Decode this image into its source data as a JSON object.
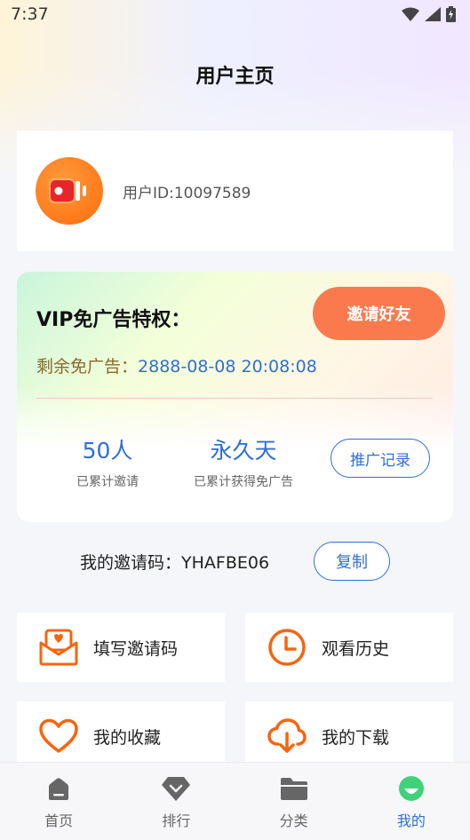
{
  "status": {
    "time": "7:37"
  },
  "page": {
    "title": "用户主页"
  },
  "user": {
    "id_text": "用户ID:10097589"
  },
  "vip": {
    "title": "VIP免广告特权：",
    "invite_button": "邀请好友",
    "remain_label": "剩余免广告：",
    "remain_value": "2888-08-08 20:08:08",
    "stats": [
      {
        "value": "50人",
        "label": "已累计邀请"
      },
      {
        "value": "永久天",
        "label": "已累计获得免广告"
      }
    ],
    "record_button": "推广记录"
  },
  "invite_code": {
    "label": "我的邀请码：YHAFBE06",
    "copy_button": "复制"
  },
  "tiles": [
    {
      "label": "填写邀请码",
      "icon": "envelope-heart-icon"
    },
    {
      "label": "观看历史",
      "icon": "clock-icon"
    },
    {
      "label": "我的收藏",
      "icon": "heart-icon"
    },
    {
      "label": "我的下载",
      "icon": "cloud-download-icon"
    }
  ],
  "tabbar": [
    {
      "label": "首页",
      "icon": "home-icon",
      "active": false
    },
    {
      "label": "排行",
      "icon": "diamond-icon",
      "active": false
    },
    {
      "label": "分类",
      "icon": "folder-icon",
      "active": false
    },
    {
      "label": "我的",
      "icon": "profile-icon",
      "active": true
    }
  ],
  "colors": {
    "accent": "#2f6fd6",
    "orange": "#fa7a4e",
    "icon_orange": "#f5650e"
  }
}
